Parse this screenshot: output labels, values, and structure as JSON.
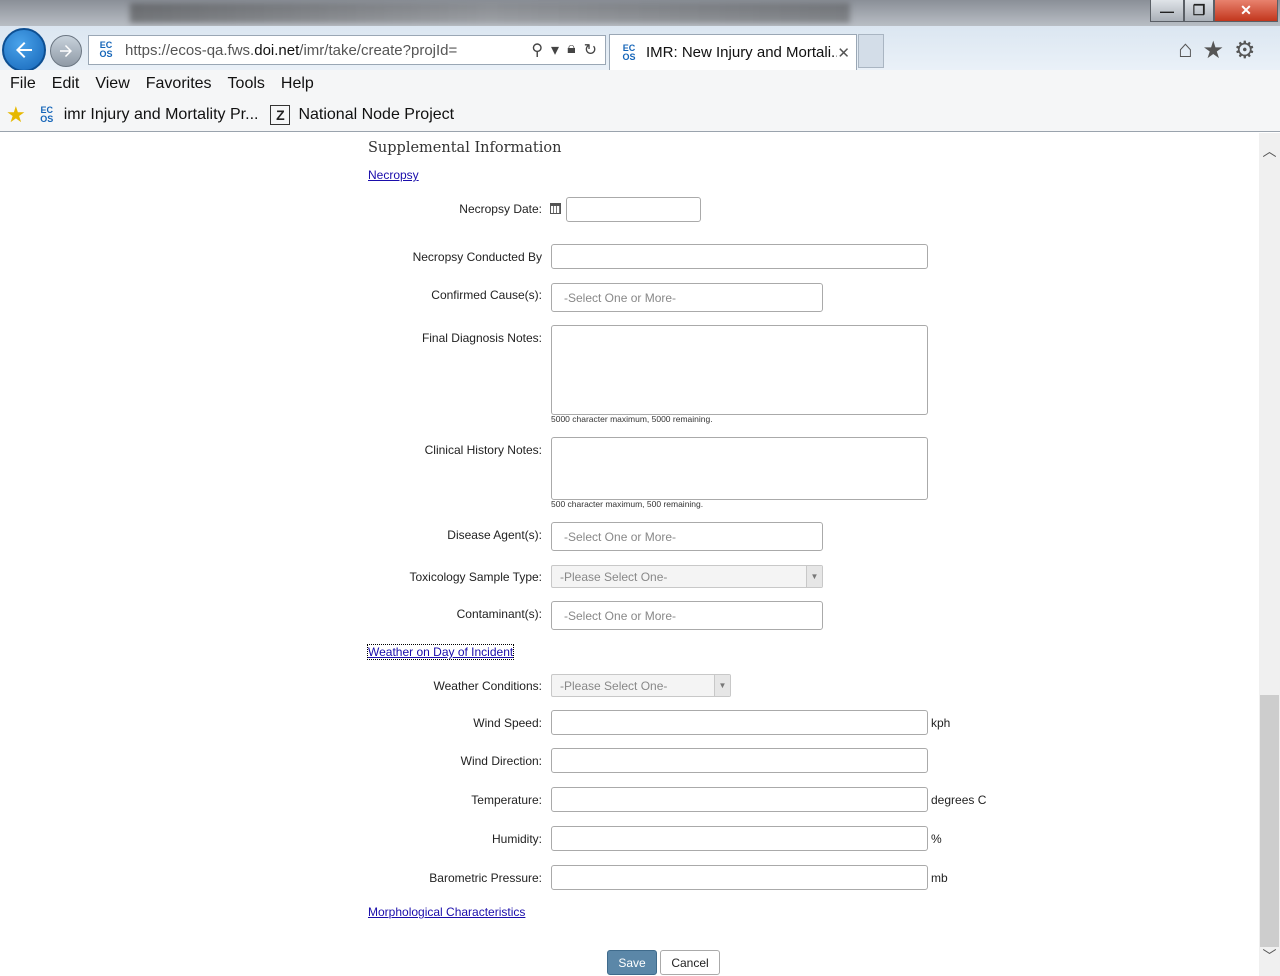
{
  "browser": {
    "url_prefix": "https://ecos-qa.fws.",
    "url_domain": "doi.net",
    "url_suffix": "/imr/take/create?projId=",
    "tab_title": "IMR: New Injury and Mortali...",
    "tab_close": "✕",
    "site_icon_text": "EC OS",
    "menu": [
      "File",
      "Edit",
      "View",
      "Favorites",
      "Tools",
      "Help"
    ],
    "favorites": [
      {
        "label": "imr Injury and Mortality Pr..."
      },
      {
        "label": "National Node Project"
      }
    ],
    "z_icon_text": "Z"
  },
  "form": {
    "section_title": "Supplemental Information",
    "necropsy_link": "Necropsy",
    "weather_link": "Weather on Day of Incident",
    "morph_link": "Morphological Characteristics",
    "fields": {
      "necropsy_date": "Necropsy Date:",
      "conducted_by": "Necropsy Conducted By",
      "confirmed_causes": "Confirmed Cause(s):",
      "confirmed_causes_ph": "-Select One or More-",
      "final_diag": "Final Diagnosis Notes:",
      "final_diag_help": "5000 character maximum, 5000 remaining.",
      "clinical_hist": "Clinical History Notes:",
      "clinical_hist_help": "500 character maximum, 500 remaining.",
      "disease_agents": "Disease Agent(s):",
      "disease_agents_ph": "-Select One or More-",
      "tox_sample": "Toxicology Sample Type:",
      "tox_sample_ph": "-Please Select One-",
      "contaminants": "Contaminant(s):",
      "contaminants_ph": "-Select One or More-",
      "weather_conditions": "Weather Conditions:",
      "weather_conditions_ph": "-Please Select One-",
      "wind_speed": "Wind Speed:",
      "wind_speed_unit": "kph",
      "wind_direction": "Wind Direction:",
      "temperature": "Temperature:",
      "temperature_unit": "degrees C",
      "humidity": "Humidity:",
      "humidity_unit": "%",
      "barometric": "Barometric Pressure:",
      "barometric_unit": "mb"
    },
    "buttons": {
      "save": "Save",
      "cancel": "Cancel"
    }
  }
}
